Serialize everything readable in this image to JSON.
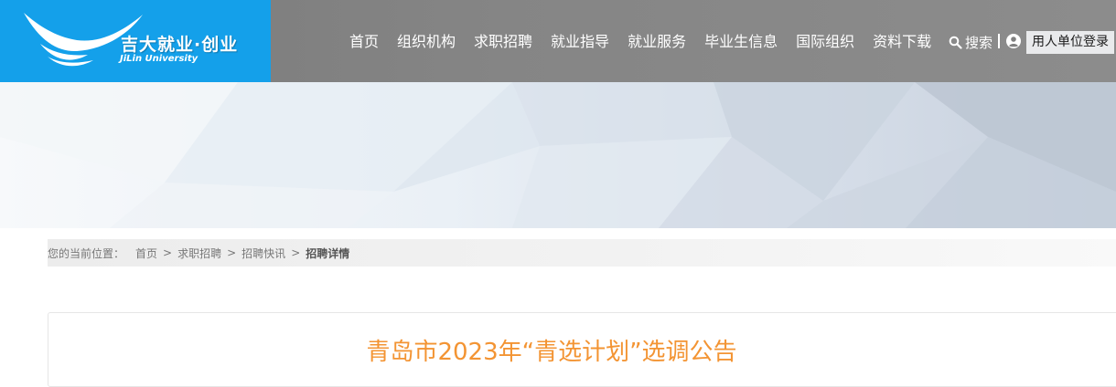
{
  "header": {
    "logo_text_cn": "吉大就业·创业",
    "logo_text_en": "JiLin University",
    "nav": [
      "首页",
      "组织机构",
      "求职招聘",
      "就业指导",
      "就业服务",
      "毕业生信息",
      "国际组织",
      "资料下载"
    ],
    "search_label": "搜索",
    "login_label": "用人单位登录"
  },
  "breadcrumb": {
    "prefix": "您的当前位置：",
    "items": [
      "首页",
      "求职招聘",
      "招聘快讯"
    ],
    "separator": ">",
    "current": "招聘详情"
  },
  "article": {
    "title": "青岛市2023年“青选计划”选调公告"
  },
  "colors": {
    "logo_bg": "#14a0ea",
    "header_bg": "#828282",
    "title": "#f39433"
  }
}
